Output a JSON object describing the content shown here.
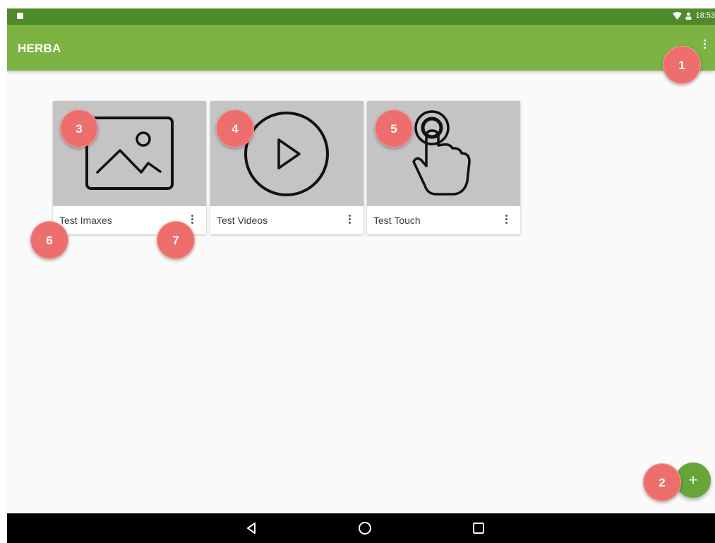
{
  "status_bar": {
    "time": "18:53"
  },
  "app_bar": {
    "title": "HERBA",
    "menu_icon": "more-vert-icon"
  },
  "cards": [
    {
      "label": "Test Imaxes",
      "icon": "image-icon"
    },
    {
      "label": "Test Videos",
      "icon": "play-circle-icon"
    },
    {
      "label": "Test Touch",
      "icon": "touch-hand-icon"
    }
  ],
  "fab": {
    "label": "+",
    "icon": "add-icon"
  },
  "nav_bar": {
    "buttons": [
      "back-icon",
      "home-icon",
      "recents-icon"
    ]
  },
  "markers": [
    "1",
    "2",
    "3",
    "4",
    "5",
    "6",
    "7"
  ],
  "colors": {
    "status_bar": "#4f8a2b",
    "app_bar": "#7cb342",
    "fab": "#66a537",
    "marker": "#ee6e6e",
    "thumb_bg": "#c4c4c4"
  }
}
